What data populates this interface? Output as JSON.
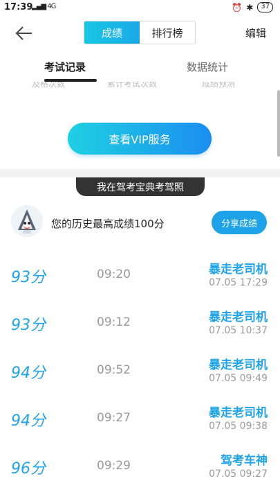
{
  "status_bar": {
    "time": "17:39",
    "signal": "4G",
    "battery": "37"
  },
  "nav": {
    "tabs": [
      "成绩",
      "排行榜"
    ],
    "edit_label": "编辑"
  },
  "sub_tabs": [
    "考试记录",
    "数据统计"
  ],
  "stats_strip": [
    "及格次数",
    "累计考试次数",
    "成绩预测"
  ],
  "vip_button": "查看VIP服务",
  "banner": "我在驾考宝典考驾照",
  "best": {
    "text": "您的历史最高成绩100分",
    "share_label": "分享成绩"
  },
  "records": [
    {
      "score": "93分",
      "duration": "09:20",
      "title": "暴走老司机",
      "date": "07.05 17:29"
    },
    {
      "score": "93分",
      "duration": "09:12",
      "title": "暴走老司机",
      "date": "07.05 10:37"
    },
    {
      "score": "94分",
      "duration": "09:52",
      "title": "暴走老司机",
      "date": "07.05 09:49"
    },
    {
      "score": "94分",
      "duration": "09:27",
      "title": "暴走老司机",
      "date": "07.05 09:38"
    },
    {
      "score": "96分",
      "duration": "09:29",
      "title": "驾考车神",
      "date": "07.05 09:27"
    }
  ]
}
